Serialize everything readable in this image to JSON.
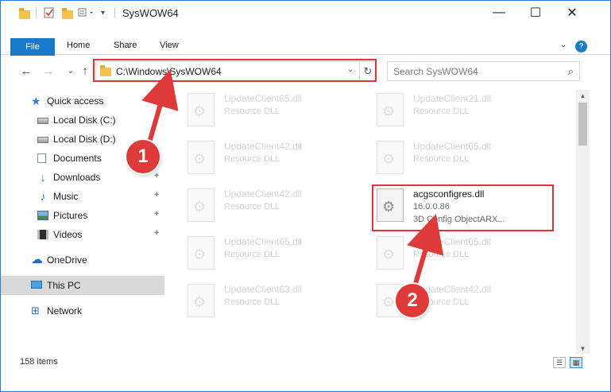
{
  "window": {
    "title": "SysWOW64",
    "controls": {
      "minimize": "—",
      "maximize": "☐",
      "close": "✕"
    }
  },
  "ribbon": {
    "file_tab": "File",
    "tabs": [
      "Home",
      "Share",
      "View"
    ],
    "expand_icon": "chevron-down-icon",
    "help_glyph": "?"
  },
  "address": {
    "path": "C:\\Windows\\SysWOW64",
    "dropdown_glyph": "⌄",
    "refresh_glyph": "↻"
  },
  "search": {
    "placeholder": "Search SysWOW64",
    "icon_glyph": "⌕"
  },
  "sidebar": {
    "items": [
      {
        "label": "Quick access",
        "icon": "star-icon"
      },
      {
        "label": "Local Disk (C:)",
        "icon": "drive-icon"
      },
      {
        "label": "Local Disk (D:)",
        "icon": "drive-icon"
      },
      {
        "label": "Documents",
        "icon": "documents-icon"
      },
      {
        "label": "Downloads",
        "icon": "download-icon",
        "pinned": true
      },
      {
        "label": "Music",
        "icon": "music-icon",
        "pinned": true
      },
      {
        "label": "Pictures",
        "icon": "pictures-icon",
        "pinned": true
      },
      {
        "label": "Videos",
        "icon": "videos-icon",
        "pinned": true
      },
      {
        "label": "OneDrive",
        "icon": "cloud-icon"
      },
      {
        "label": "This PC",
        "icon": "computer-icon",
        "selected": true
      },
      {
        "label": "Network",
        "icon": "network-icon"
      }
    ],
    "pin_glyph": "📌"
  },
  "files": [
    {
      "name": "UpdateClient65.dll",
      "desc": "Resource DLL"
    },
    {
      "name": "UpdateClient21.dll",
      "desc": "Resource DLL"
    },
    {
      "name": "UpdateClient42.dll",
      "desc": "Resource DLL"
    },
    {
      "name": "UpdateClient65.dll",
      "desc": "Resource DLL"
    },
    {
      "name": "UpdateClient42.dll",
      "desc": "Resource DLL"
    },
    {
      "name": "acgsconfigres.dll",
      "desc": "16.0.0.86",
      "desc2": "3D Config ObjectARX...",
      "highlighted": true
    },
    {
      "name": "UpdateClient65.dll",
      "desc": "Resource DLL"
    },
    {
      "name": "UpdateClient65.dll",
      "desc": "Resource DLL"
    },
    {
      "name": "UpdateClient63.dll",
      "desc": "Resource DLL"
    },
    {
      "name": "UpdateClient42.dll",
      "desc": "Resource DLL"
    }
  ],
  "status": {
    "item_count": "158 items"
  },
  "annotations": {
    "badge1": "1",
    "badge2": "2",
    "color": "#d9373c"
  }
}
